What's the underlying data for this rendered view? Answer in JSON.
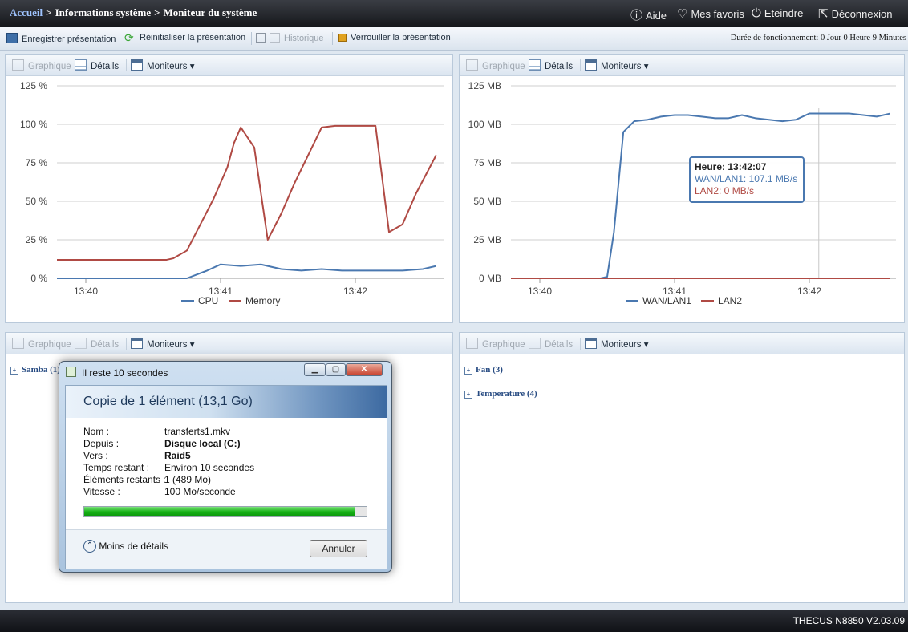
{
  "breadcrumb": {
    "home": "Accueil",
    "sep": ">",
    "level1": "Informations système",
    "level2": "Moniteur du système"
  },
  "topnav": {
    "help": "Aide",
    "favorites": "Mes favoris",
    "shutdown": "Eteindre",
    "logout": "Déconnexion"
  },
  "toolbar": {
    "save": "Enregistrer présentation",
    "reset": "Réinitialiser la présentation",
    "history": "Historique",
    "lock": "Verrouiller la présentation",
    "uptime": "Durée de fonctionnement:  0 Jour 0 Heure 9 Minutes"
  },
  "panel": {
    "graph": "Graphique",
    "details": "Détails",
    "monitors": "Moniteurs",
    "monitors_arrow": "▾"
  },
  "groups": {
    "samba": "Samba (1)",
    "fan": "Fan (3)",
    "temperature": "Temperature (4)"
  },
  "chart_data": [
    {
      "type": "line",
      "yticks": [
        "125 %",
        "100 %",
        "75 %",
        "50 %",
        "25 %",
        "0 %"
      ],
      "xticks": [
        "13:40",
        "13:41",
        "13:42"
      ],
      "ylim": [
        0,
        125
      ],
      "grid": true,
      "legend": "bottom",
      "series": [
        {
          "name": "CPU",
          "color": "#4a78b0",
          "x": [
            -0.22,
            0.3,
            0.45,
            0.6,
            0.75,
            0.9,
            1.0,
            1.15,
            1.3,
            1.45,
            1.6,
            1.75,
            1.9,
            2.05,
            2.2,
            2.35,
            2.5,
            2.6
          ],
          "y": [
            0,
            0,
            0,
            0,
            0,
            5,
            9,
            8,
            9,
            6,
            5,
            6,
            5,
            5,
            5,
            5,
            6,
            8
          ]
        },
        {
          "name": "Memory",
          "color": "#b04a44",
          "x": [
            -0.22,
            0.3,
            0.5,
            0.6,
            0.65,
            0.75,
            0.85,
            0.95,
            1.05,
            1.1,
            1.15,
            1.25,
            1.35,
            1.45,
            1.55,
            1.65,
            1.75,
            1.85,
            1.95,
            2.05,
            2.15,
            2.25,
            2.35,
            2.45,
            2.6
          ],
          "y": [
            12,
            12,
            12,
            12,
            13,
            18,
            35,
            52,
            72,
            88,
            98,
            85,
            25,
            42,
            62,
            80,
            98,
            99,
            99,
            99,
            99,
            30,
            35,
            55,
            80
          ]
        }
      ]
    },
    {
      "type": "line",
      "yticks": [
        "125 MB",
        "100 MB",
        "75 MB",
        "50 MB",
        "25 MB",
        "0 MB"
      ],
      "xticks": [
        "13:40",
        "13:41",
        "13:42"
      ],
      "ylim": [
        0,
        125
      ],
      "grid": true,
      "legend": "bottom",
      "series": [
        {
          "name": "WAN/LAN1",
          "color": "#4a78b0",
          "x": [
            -0.22,
            0.45,
            0.5,
            0.55,
            0.62,
            0.7,
            0.8,
            0.9,
            1.0,
            1.1,
            1.2,
            1.3,
            1.4,
            1.5,
            1.6,
            1.7,
            1.8,
            1.9,
            2.0,
            2.1,
            2.2,
            2.3,
            2.4,
            2.5,
            2.6
          ],
          "y": [
            0,
            0,
            1,
            30,
            95,
            102,
            103,
            105,
            106,
            106,
            105,
            104,
            104,
            106,
            104,
            103,
            102,
            103,
            107,
            107,
            107,
            107,
            106,
            105,
            107
          ]
        },
        {
          "name": "LAN2",
          "color": "#b04a44",
          "x": [
            -0.22,
            2.6
          ],
          "y": [
            0,
            0
          ]
        }
      ],
      "tooltip": {
        "title": "Heure: 13:42:07",
        "line1": "WAN/LAN1: 107.1 MB/s",
        "line2": "LAN2: 0 MB/s"
      }
    }
  ],
  "dialog": {
    "title": "Il reste 10 secondes",
    "heading": "Copie de 1 élément (13,1 Go)",
    "rows": [
      {
        "label": "Nom :",
        "value": "transferts1.mkv",
        "bold": false
      },
      {
        "label": "Depuis :",
        "value": "Disque local (C:)",
        "bold": true
      },
      {
        "label": "Vers :",
        "value": "Raid5",
        "bold": true
      },
      {
        "label": "Temps restant :",
        "value": "Environ 10 secondes",
        "bold": false
      },
      {
        "label": "Éléments restants :",
        "value": "1 (489 Mo)",
        "bold": false
      },
      {
        "label": "Vitesse :",
        "value": "100 Mo/seconde",
        "bold": false
      }
    ],
    "progress": 0.96,
    "less_details": "Moins de détails",
    "cancel": "Annuler"
  },
  "footer": {
    "version": "THECUS N8850 V2.03.09"
  },
  "colors": {
    "accent": "#274b82",
    "progress": "#1fc11f",
    "cpu": "#4a78b0",
    "memory": "#b04a44"
  }
}
